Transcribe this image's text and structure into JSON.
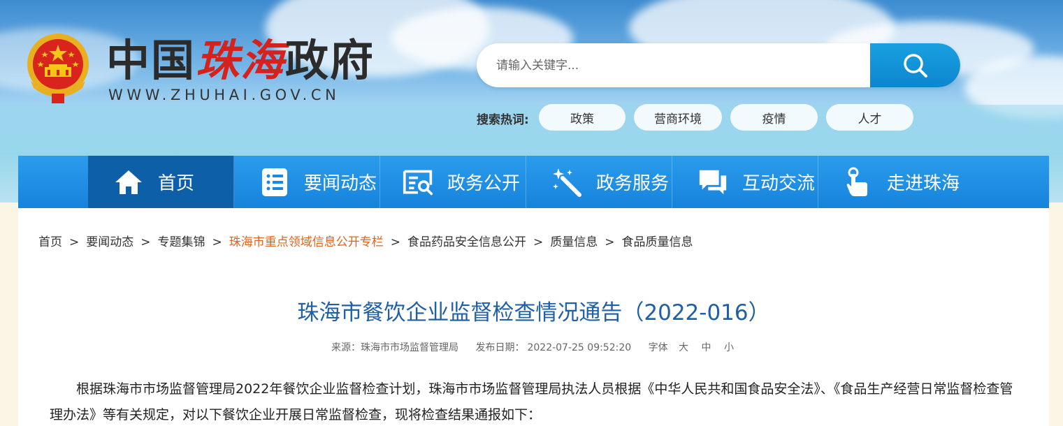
{
  "header": {
    "site_name_part1": "中国",
    "site_name_part2": "珠海",
    "site_name_part3": "政府",
    "site_url": "WWW.ZHUHAI.GOV.CN"
  },
  "search": {
    "placeholder": "请输入关键字...",
    "hot_label": "搜索热词:",
    "hot_tags": [
      "政策",
      "营商环境",
      "疫情",
      "人才"
    ]
  },
  "nav": {
    "items": [
      {
        "label": "首页",
        "icon": "home-icon"
      },
      {
        "label": "要闻动态",
        "icon": "list-icon"
      },
      {
        "label": "政务公开",
        "icon": "document-search-icon"
      },
      {
        "label": "政务服务",
        "icon": "magic-wand-icon"
      },
      {
        "label": "互动交流",
        "icon": "chat-icon"
      },
      {
        "label": "走进珠海",
        "icon": "tap-hand-icon"
      }
    ]
  },
  "breadcrumb": {
    "items": [
      "首页",
      "要闻动态",
      "专题集锦",
      "珠海市重点领域信息公开专栏",
      "食品药品安全信息公开",
      "质量信息",
      "食品质量信息"
    ],
    "separator": ">"
  },
  "article": {
    "title": "珠海市餐饮企业监督检查情况通告（2022-016）",
    "source": "来源：珠海市市场监督管理局",
    "publish_label": "发布日期：",
    "publish_date": "2022-07-25 09:52:20",
    "font_size_label": "字体",
    "font_sizes": [
      "大",
      "中",
      "小"
    ],
    "paragraph": "根据珠海市市场监督管理局2022年餐饮企业监督检查计划，珠海市市场监督管理局执法人员根据《中华人民共和国食品安全法》、《食品生产经营日常监督检查管理办法》等有关规定，对以下餐饮企业开展日常监督检查，现将检查结果通报如下："
  },
  "colors": {
    "nav_bg": "#1683dc",
    "nav_active": "#0d5fa8",
    "title_blue": "#1e5fa8",
    "breadcrumb_highlight": "#e0631b",
    "brand_red": "#d4221d"
  }
}
